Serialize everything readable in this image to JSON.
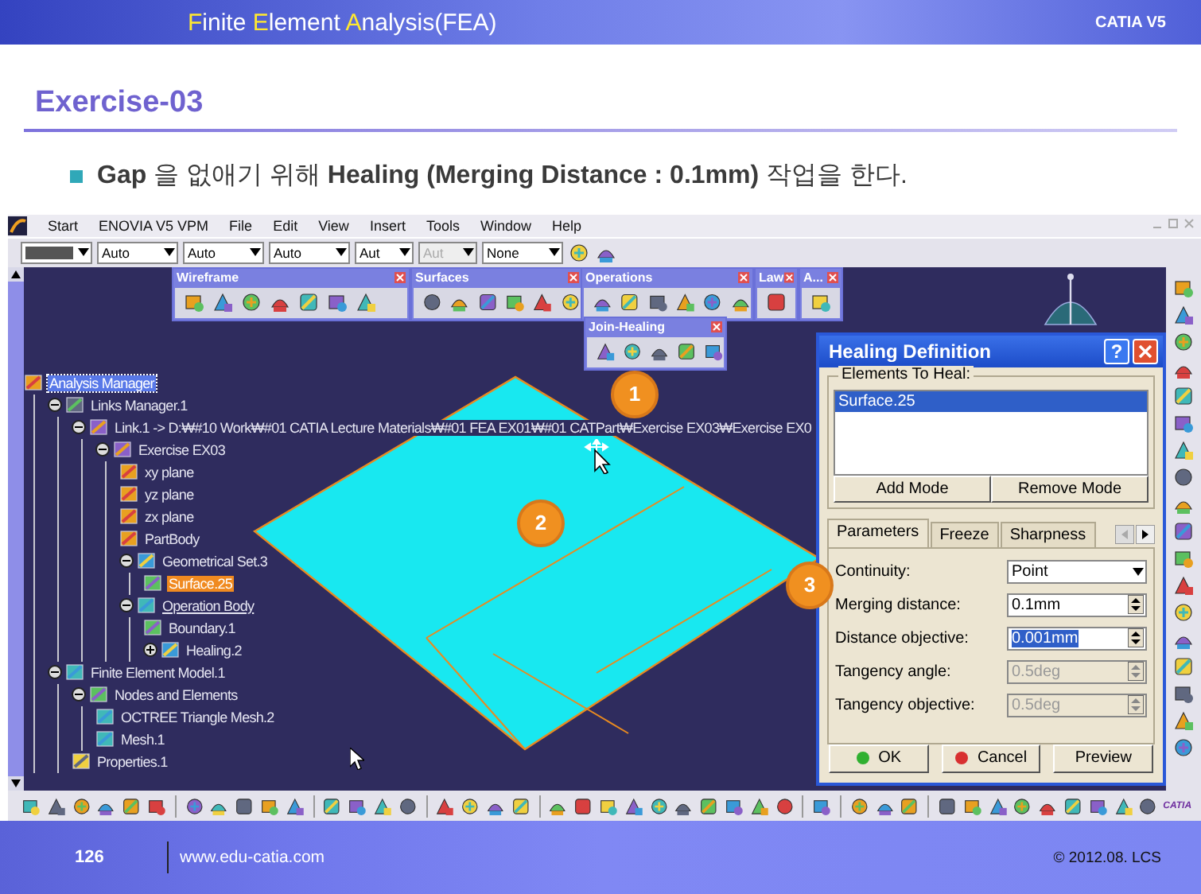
{
  "header": {
    "title_parts": [
      {
        "text": "F",
        "accent": true
      },
      {
        "text": "inite ",
        "accent": false
      },
      {
        "text": "E",
        "accent": true
      },
      {
        "text": "lement ",
        "accent": false
      },
      {
        "text": "A",
        "accent": true
      },
      {
        "text": "nalysis(FEA)",
        "accent": false
      }
    ],
    "product": "CATIA V5"
  },
  "heading": "Exercise-03",
  "bullet": "**Gap** 을 없애기 위해  **Healing (Merging Distance : 0.1mm)** 작업을 한다.",
  "app": {
    "menu": [
      "Start",
      "ENOVIA V5 VPM",
      "File",
      "Edit",
      "View",
      "Insert",
      "Tools",
      "Window",
      "Help"
    ],
    "combos": [
      {
        "kind": "swatch",
        "disabled": false
      },
      {
        "kind": "text",
        "value": "Auto",
        "disabled": false
      },
      {
        "kind": "text",
        "value": "Auto",
        "disabled": false
      },
      {
        "kind": "text",
        "value": "Auto",
        "disabled": false
      },
      {
        "kind": "text",
        "value": "Aut",
        "disabled": false
      },
      {
        "kind": "text",
        "value": "Aut",
        "disabled": true
      },
      {
        "kind": "text",
        "value": "None",
        "disabled": false
      }
    ],
    "floating_toolbars": [
      {
        "title": "Wireframe"
      },
      {
        "title": "Surfaces"
      },
      {
        "title": "Operations"
      },
      {
        "title": "Law"
      },
      {
        "title": "A..."
      },
      {
        "title": "Join-Healing"
      }
    ],
    "tree": [
      {
        "label": "Analysis Manager",
        "selected": true,
        "highlighted": false,
        "underlined": false,
        "children": [
          {
            "label": "Links Manager.1",
            "selected": false,
            "highlighted": false,
            "underlined": false,
            "expanded": true,
            "children": [
              {
                "label": "Link.1 -> D:₩#10 Work₩#01 CATIA Lecture Materials₩#01 FEA EX01₩#01 CATPart₩Exercise EX03₩Exercise EX0",
                "selected": false,
                "highlighted": false,
                "underlined": false,
                "expanded": true,
                "children": [
                  {
                    "label": "Exercise EX03",
                    "selected": false,
                    "highlighted": false,
                    "underlined": false,
                    "expanded": true,
                    "children": [
                      {
                        "label": "xy plane",
                        "selected": false,
                        "highlighted": false,
                        "underlined": false
                      },
                      {
                        "label": "yz plane",
                        "selected": false,
                        "highlighted": false,
                        "underlined": false
                      },
                      {
                        "label": "zx plane",
                        "selected": false,
                        "highlighted": false,
                        "underlined": false
                      },
                      {
                        "label": "PartBody",
                        "selected": false,
                        "highlighted": false,
                        "underlined": false
                      },
                      {
                        "label": "Geometrical Set.3",
                        "selected": false,
                        "highlighted": false,
                        "underlined": false,
                        "expanded": true,
                        "children": [
                          {
                            "label": "Surface.25",
                            "selected": false,
                            "highlighted": true,
                            "underlined": false
                          }
                        ]
                      },
                      {
                        "label": "Operation Body",
                        "selected": false,
                        "highlighted": false,
                        "underlined": true,
                        "expanded": true,
                        "children": [
                          {
                            "label": "Boundary.1",
                            "selected": false,
                            "highlighted": false,
                            "underlined": false
                          },
                          {
                            "label": "Healing.2",
                            "selected": false,
                            "highlighted": false,
                            "underlined": false,
                            "expanded": false
                          }
                        ]
                      }
                    ]
                  }
                ]
              }
            ]
          },
          {
            "label": "Finite Element Model.1",
            "selected": false,
            "highlighted": false,
            "underlined": false,
            "expanded": true,
            "children": [
              {
                "label": "Nodes and Elements",
                "selected": false,
                "highlighted": false,
                "underlined": false,
                "expanded": true,
                "children": [
                  {
                    "label": "OCTREE Triangle Mesh.2",
                    "selected": false,
                    "highlighted": false,
                    "underlined": false
                  },
                  {
                    "label": "Mesh.1",
                    "selected": false,
                    "highlighted": false,
                    "underlined": false
                  }
                ]
              },
              {
                "label": "Properties.1",
                "selected": false,
                "highlighted": false,
                "underlined": false
              }
            ]
          }
        ]
      }
    ],
    "callouts": [
      "1",
      "2",
      "3"
    ],
    "dialog": {
      "title": "Healing Definition",
      "help": "?",
      "group": "Elements To Heal:",
      "elements": [
        {
          "label": "Surface.25",
          "selected": true
        }
      ],
      "mode_buttons": [
        "Add Mode",
        "Remove Mode"
      ],
      "tabs": [
        {
          "label": "Parameters",
          "selected": true
        },
        {
          "label": "Freeze",
          "selected": false
        },
        {
          "label": "Sharpness",
          "selected": false
        }
      ],
      "fields": [
        {
          "kind": "combo",
          "label": "Continuity:",
          "value": "Point",
          "disabled": false,
          "selected": false
        },
        {
          "kind": "spin",
          "label": "Merging distance:",
          "value": "0.1mm",
          "disabled": false,
          "selected": false
        },
        {
          "kind": "spin",
          "label": "Distance objective:",
          "value": "0.001mm",
          "disabled": false,
          "selected": true
        },
        {
          "kind": "spin",
          "label": "Tangency angle:",
          "value": "0.5deg",
          "disabled": true,
          "selected": false
        },
        {
          "kind": "spin",
          "label": "Tangency objective:",
          "value": "0.5deg",
          "disabled": true,
          "selected": false
        }
      ],
      "buttons": [
        {
          "label": "OK",
          "kind": "ok"
        },
        {
          "label": "Cancel",
          "kind": "cancel"
        },
        {
          "label": "Preview",
          "kind": "plain"
        }
      ]
    },
    "logo_text": "CATIA"
  },
  "footer": {
    "page": "126",
    "site": "www.edu-catia.com",
    "copyright": "© 2012.08. LCS"
  }
}
